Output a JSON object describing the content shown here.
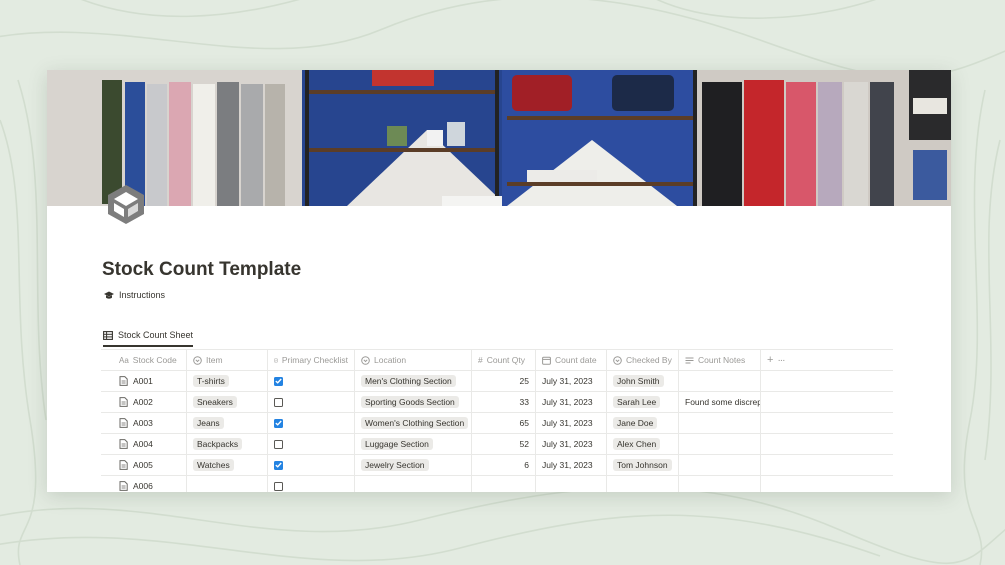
{
  "page": {
    "title": "Stock Count Template",
    "instructions_label": "Instructions",
    "view_tab_label": "Stock Count Sheet",
    "help_label": "?"
  },
  "table": {
    "headers": {
      "code": "Stock Code",
      "item": "Item",
      "checklist": "Primary Checklist",
      "location": "Location",
      "qty": "Count Qty",
      "date": "Count date",
      "by": "Checked By",
      "notes": "Count Notes"
    },
    "rows": [
      {
        "code": "A001",
        "item": "T-shirts",
        "checked": true,
        "location": "Men's Clothing Section",
        "qty": "25",
        "date": "July 31, 2023",
        "by": "John Smith",
        "notes": ""
      },
      {
        "code": "A002",
        "item": "Sneakers",
        "checked": false,
        "location": "Sporting Goods Section",
        "qty": "33",
        "date": "July 31, 2023",
        "by": "Sarah Lee",
        "notes": "Found some discrep"
      },
      {
        "code": "A003",
        "item": "Jeans",
        "checked": true,
        "location": "Women's Clothing Section",
        "qty": "65",
        "date": "July 31, 2023",
        "by": "Jane Doe",
        "notes": ""
      },
      {
        "code": "A004",
        "item": "Backpacks",
        "checked": false,
        "location": "Luggage Section",
        "qty": "52",
        "date": "July 31, 2023",
        "by": "Alex Chen",
        "notes": ""
      },
      {
        "code": "A005",
        "item": "Watches",
        "checked": true,
        "location": "Jewelry Section",
        "qty": "6",
        "date": "July 31, 2023",
        "by": "Tom Johnson",
        "notes": ""
      },
      {
        "code": "A006",
        "item": "",
        "checked": false,
        "location": "",
        "qty": "",
        "date": "",
        "by": "",
        "notes": ""
      }
    ]
  },
  "colors": {
    "background": "#e3ebe1",
    "text": "#37352f",
    "muted": "#9b9a97",
    "checkbox_checked": "#2383e2",
    "tag_bg": "#ebeae7"
  },
  "icons": {
    "page_icon": "box-logo-icon",
    "instructions": "graduation-cap-icon",
    "view_tab": "table-icon",
    "col_code": "text-aa-icon",
    "col_item": "select-icon",
    "col_checklist": "checkbox-icon",
    "col_location": "select-icon",
    "col_qty": "hash-icon",
    "col_date": "calendar-icon",
    "col_by": "select-icon",
    "col_notes": "lines-icon",
    "row_code": "page-icon"
  }
}
